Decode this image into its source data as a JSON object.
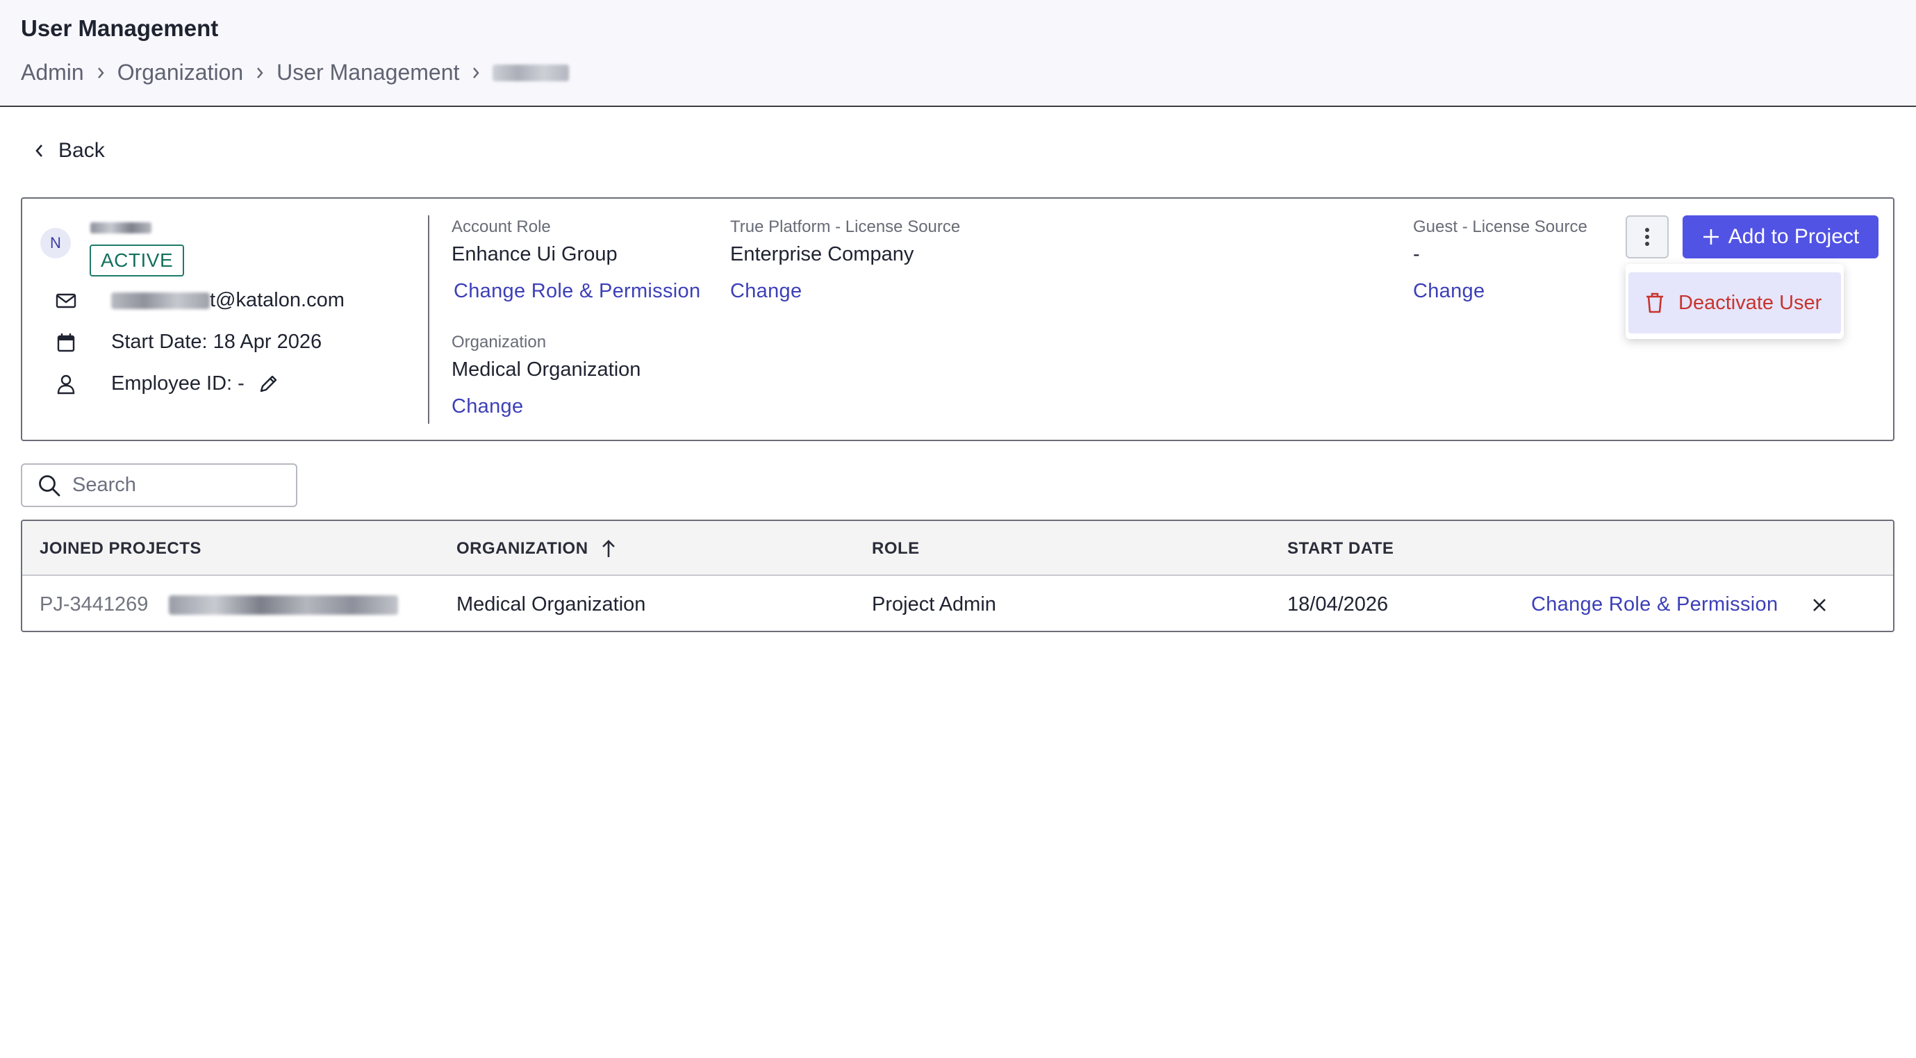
{
  "header": {
    "title": "User Management",
    "breadcrumb": [
      "Admin",
      "Organization",
      "User Management"
    ]
  },
  "back_label": "Back",
  "user": {
    "avatar_initial": "N",
    "status": "ACTIVE",
    "email_suffix": "t@katalon.com",
    "start_date": "Start Date: 18 Apr 2026",
    "employee_id": "Employee ID: -"
  },
  "account_role": {
    "label": "Account Role",
    "value": "Enhance Ui Group",
    "action": "Change Role & Permission"
  },
  "true_platform": {
    "label": "True Platform - License Source",
    "value": "Enterprise Company",
    "action": "Change"
  },
  "guest": {
    "label": "Guest - License Source",
    "value": "-",
    "action": "Change"
  },
  "organization": {
    "label": "Organization",
    "value": "Medical Organization",
    "action": "Change"
  },
  "actions": {
    "add_to_project": "Add to Project",
    "deactivate_user": "Deactivate User"
  },
  "search": {
    "placeholder": "Search"
  },
  "table": {
    "columns": [
      "JOINED PROJECTS",
      "ORGANIZATION",
      "ROLE",
      "START DATE"
    ],
    "sorted_column": "ORGANIZATION",
    "sort_direction": "ascending",
    "rows": [
      {
        "project_id": "PJ-3441269",
        "organization": "Medical Organization",
        "role": "Project Admin",
        "start_date": "18/04/2026",
        "action": "Change Role & Permission"
      }
    ]
  },
  "colors": {
    "primary": "#5153e4",
    "link": "#3c3fb8",
    "active": "#14705e",
    "danger": "#c9332e"
  }
}
